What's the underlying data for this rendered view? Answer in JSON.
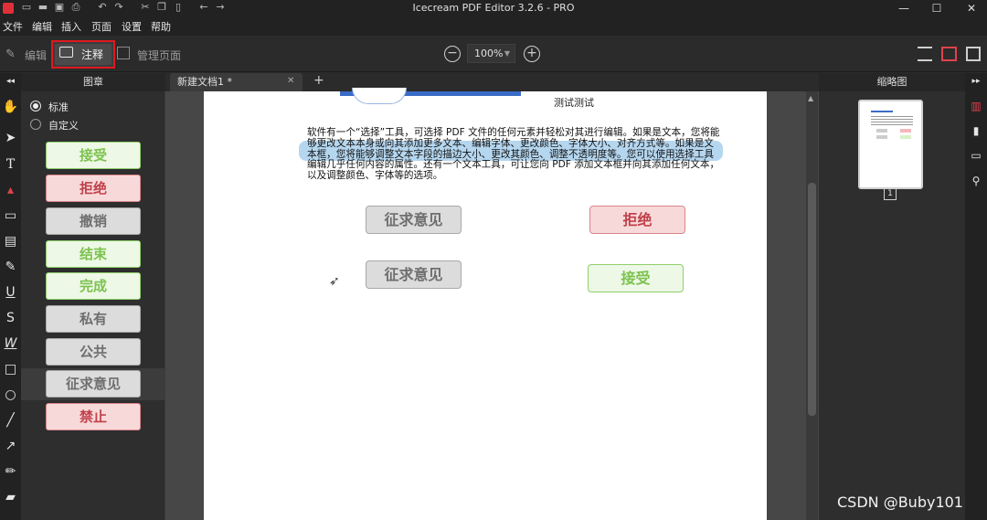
{
  "window": {
    "title": "Icecream PDF Editor 3.2.6 - PRO",
    "controls": {
      "minimize": "—",
      "maximize": "☐",
      "close": "✕"
    }
  },
  "menu": [
    "文件",
    "编辑",
    "插入",
    "页面",
    "设置",
    "帮助"
  ],
  "toolbar": {
    "edit_label": "编辑",
    "annotate_label": "注释",
    "manage_pages_label": "管理页面",
    "zoom": "100%"
  },
  "stamp_panel": {
    "title": "图章",
    "radio_standard": "标准",
    "radio_custom": "自定义",
    "selected_radio": "标准",
    "stamps": [
      {
        "label": "接受",
        "style": "green"
      },
      {
        "label": "拒绝",
        "style": "red"
      },
      {
        "label": "撤销",
        "style": "gray"
      },
      {
        "label": "结束",
        "style": "green"
      },
      {
        "label": "完成",
        "style": "green"
      },
      {
        "label": "私有",
        "style": "gray"
      },
      {
        "label": "公共",
        "style": "gray"
      },
      {
        "label": "征求意见",
        "style": "gray",
        "selected": true
      },
      {
        "label": "禁止",
        "style": "red"
      }
    ]
  },
  "tabs": [
    {
      "label": "新建文档1 *",
      "close": "✕"
    }
  ],
  "tab_add": "+",
  "document": {
    "heading": "测试测试",
    "paragraph": "软件有一个“选择”工具，可选择 PDF 文件的任何元素并轻松对其进行编辑。如果是文本，您将能够更改文本本身或向其添加更多文本、编辑字体、更改颜色、字体大小、对齐方式等。如果是文本框，您将能够调整文本字段的描边大小、更改其颜色、调整不透明度等。您可以使用选择工具编辑几乎任何内容的属性。还有一个文本工具，可让您向 PDF 添加文本框并向其添加任何文本，以及调整颜色、字体等的选项。",
    "stamps": [
      {
        "label": "征求意见",
        "style": "gray"
      },
      {
        "label": "拒绝",
        "style": "red"
      },
      {
        "label": "征求意见",
        "style": "gray"
      },
      {
        "label": "接受",
        "style": "green"
      }
    ]
  },
  "thumbnails": {
    "title": "缩略图",
    "page_number": "1"
  },
  "watermark": "CSDN @Buby101",
  "colors": {
    "highlight_border": "#e0191f",
    "stamp_green": "#7cc24f",
    "stamp_red": "#c0424c",
    "stamp_gray": "#6e6e6e"
  }
}
